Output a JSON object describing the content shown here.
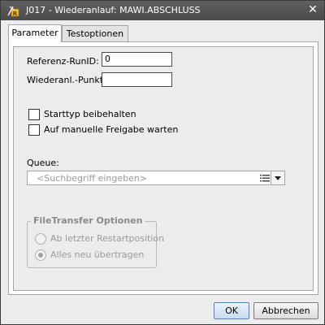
{
  "window": {
    "title": "J017 - Wiederanlauf: MAWI.ABSCHLUSS"
  },
  "tabs": [
    {
      "label": "Parameter",
      "active": true
    },
    {
      "label": "Testoptionen",
      "active": false
    }
  ],
  "form": {
    "referenz_label": "Referenz-RunID:",
    "referenz_value": "0",
    "wiederanl_label": "Wiederanl.-Punkt:",
    "wiederanl_value": "",
    "starttyp_label": "Starttyp beibehalten",
    "starttyp_checked": false,
    "freigabe_label": "Auf manuelle Freigabe warten",
    "freigabe_checked": false,
    "queue_label": "Queue:",
    "queue_placeholder": "<Suchbegriff eingeben>"
  },
  "filetransfer": {
    "title": "FileTransfer Optionen",
    "options": [
      {
        "label": "Ab letzter Restartposition",
        "selected": false
      },
      {
        "label": "Alles neu übertragen",
        "selected": true
      }
    ]
  },
  "buttons": {
    "ok": "OK",
    "cancel": "Abbrechen"
  },
  "icons": {
    "app": "jobstart-icon",
    "close": "close-icon",
    "list": "list-icon",
    "dropdown": "chevron-down-icon"
  },
  "colors": {
    "titlebar": "#555555",
    "panel_bg": "#ececec",
    "primary_button": "#c9dbef",
    "disabled_text": "#9a9a9a"
  }
}
